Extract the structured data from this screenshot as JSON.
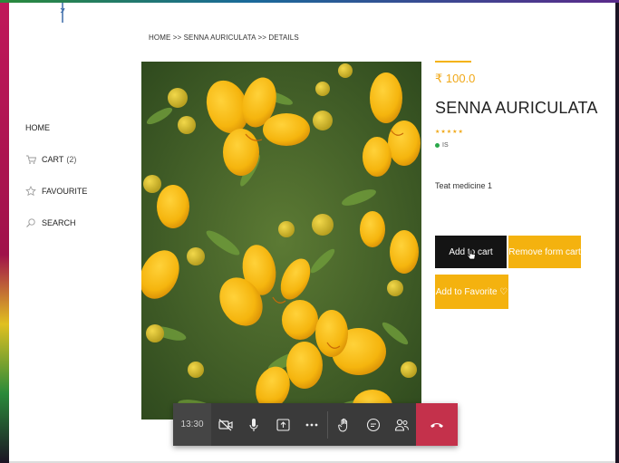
{
  "breadcrumb": "HOME >> SENNA AURICULATA >> DETAILS",
  "nav": {
    "home": "HOME",
    "cart": "CART",
    "cart_count": "(2)",
    "favourite": "FAVOURITE",
    "search": "SEARCH"
  },
  "product": {
    "price": "₹ 100.0",
    "title": "SENNA AURICULATA",
    "stars": "★★★★★",
    "stock": "IS",
    "description": "Teat medicine 1"
  },
  "buttons": {
    "add_to_cart": "Add to cart",
    "remove_from_cart": "Remove form cart",
    "add_to_favorite": "Add to Favorite ♡"
  },
  "meeting": {
    "time": "13:30",
    "icons": [
      "camera-off-icon",
      "mic-icon",
      "share-screen-icon",
      "more-icon",
      "raise-hand-icon",
      "chat-icon",
      "participants-icon",
      "hang-up-icon"
    ]
  },
  "colors": {
    "accent": "#f4b20f",
    "price": "#f0a818",
    "dark_button": "#141414",
    "hang_up": "#c4314b",
    "stock_dot": "#2aa84a"
  }
}
